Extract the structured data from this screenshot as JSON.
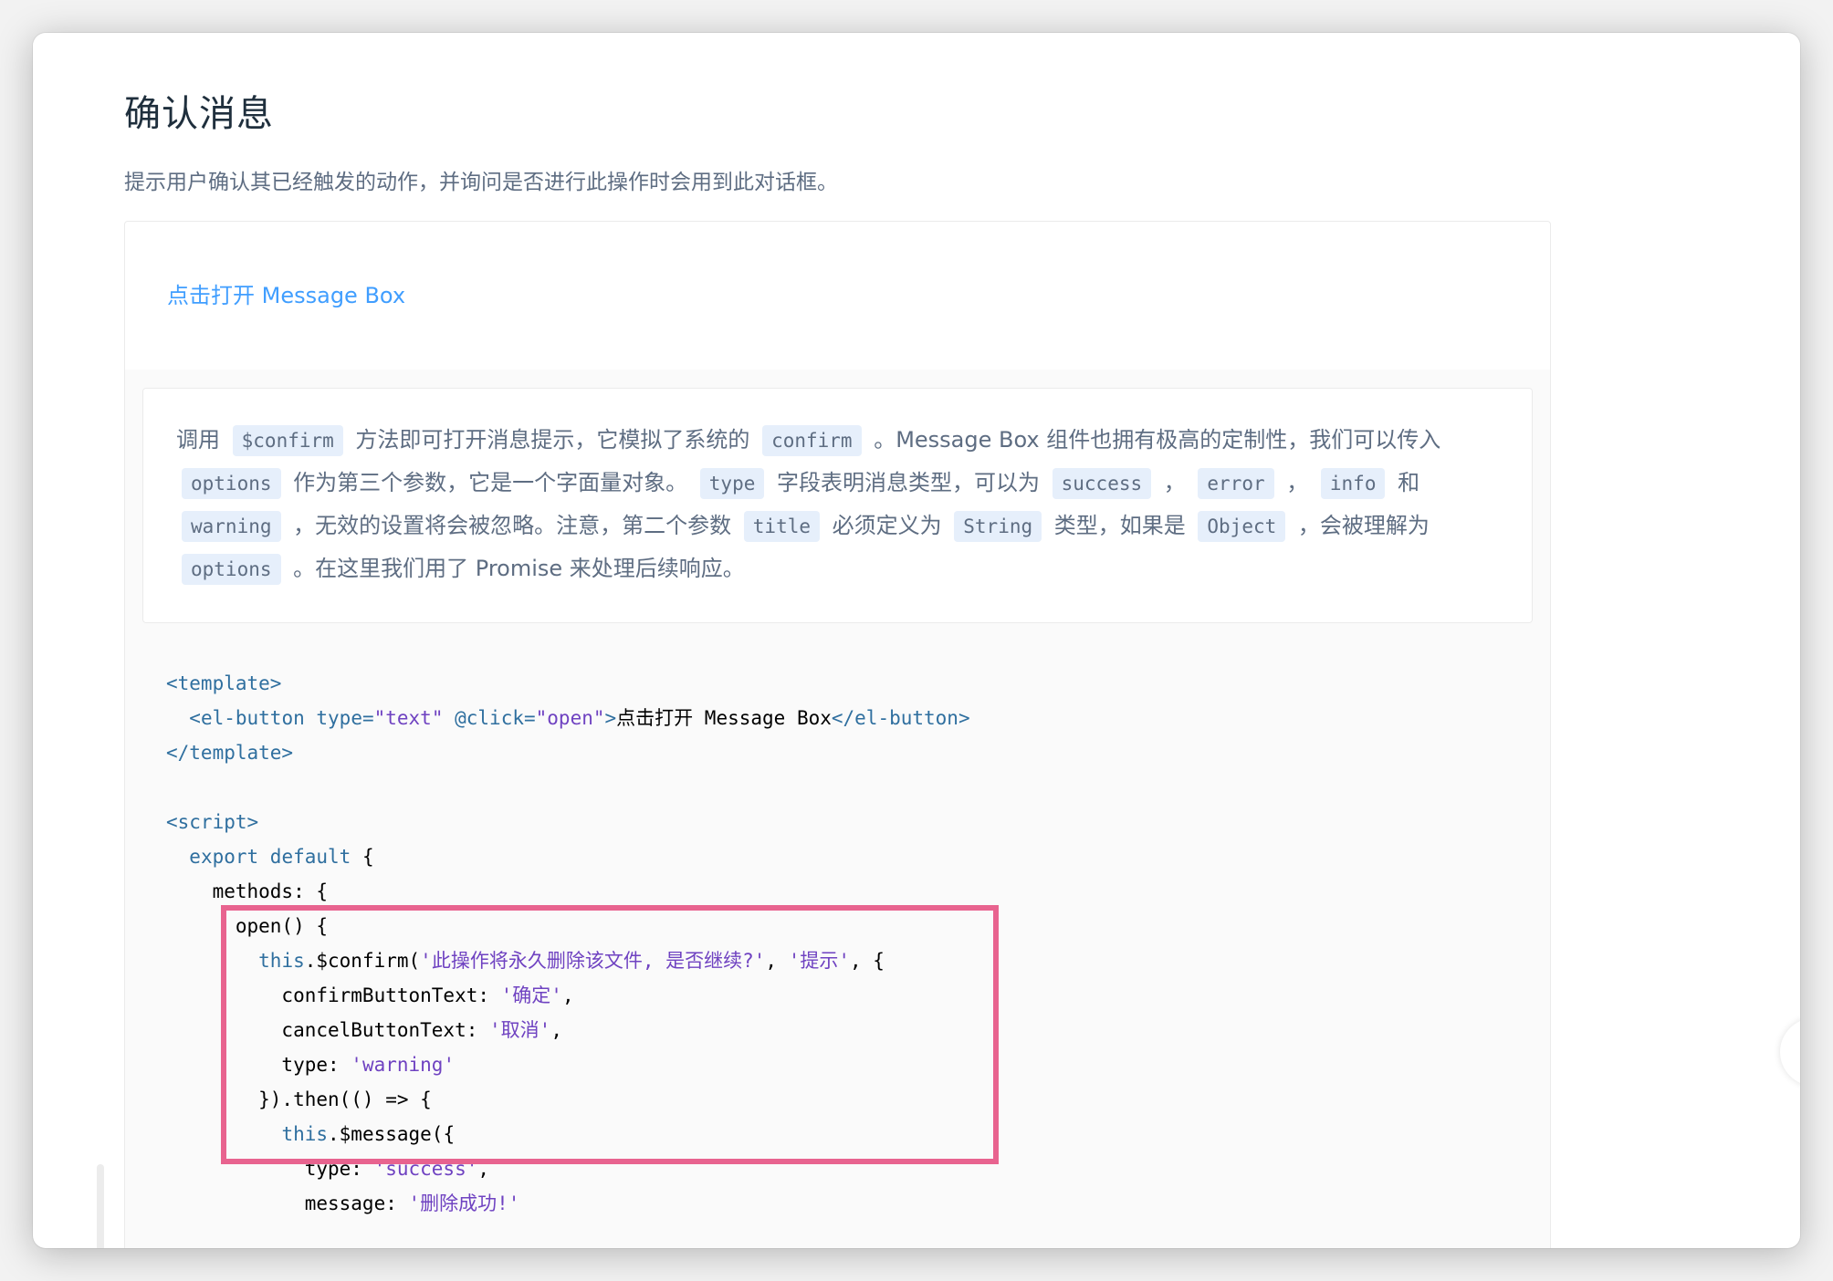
{
  "page": {
    "title": "确认消息",
    "description": "提示用户确认其已经触发的动作，并询问是否进行此操作时会用到此对话框。"
  },
  "demo": {
    "open_link": "点击打开 Message Box"
  },
  "description_parts": [
    {
      "t": "text",
      "v": "调用 "
    },
    {
      "t": "code",
      "v": "$confirm"
    },
    {
      "t": "text",
      "v": " 方法即可打开消息提示，它模拟了系统的 "
    },
    {
      "t": "code",
      "v": "confirm"
    },
    {
      "t": "text",
      "v": " 。Message Box 组件也拥有极高的定制性，我们可以传入 "
    },
    {
      "t": "code",
      "v": "options"
    },
    {
      "t": "text",
      "v": " 作为第三个参数，它是一个字面量对象。 "
    },
    {
      "t": "code",
      "v": "type"
    },
    {
      "t": "text",
      "v": " 字段表明消息类型，可以为 "
    },
    {
      "t": "code",
      "v": "success"
    },
    {
      "t": "text",
      "v": " ， "
    },
    {
      "t": "code",
      "v": "error"
    },
    {
      "t": "text",
      "v": " ， "
    },
    {
      "t": "code",
      "v": "info"
    },
    {
      "t": "text",
      "v": " 和 "
    },
    {
      "t": "code",
      "v": "warning"
    },
    {
      "t": "text",
      "v": " ，无效的设置将会被忽略。注意，第二个参数 "
    },
    {
      "t": "code",
      "v": "title"
    },
    {
      "t": "text",
      "v": " 必须定义为 "
    },
    {
      "t": "code",
      "v": "String"
    },
    {
      "t": "text",
      "v": " 类型，如果是 "
    },
    {
      "t": "code",
      "v": "Object"
    },
    {
      "t": "text",
      "v": " ，会被理解为 "
    },
    {
      "t": "code",
      "v": "options"
    },
    {
      "t": "text",
      "v": " 。在这里我们用了 Promise 来处理后续响应。"
    }
  ],
  "code_lines": [
    [
      {
        "c": "tag",
        "v": "<template>"
      }
    ],
    [
      {
        "c": "plain",
        "v": "  "
      },
      {
        "c": "tag",
        "v": "<el-button"
      },
      {
        "c": "plain",
        "v": " "
      },
      {
        "c": "attr",
        "v": "type="
      },
      {
        "c": "str",
        "v": "\"text\""
      },
      {
        "c": "plain",
        "v": " "
      },
      {
        "c": "attr",
        "v": "@click="
      },
      {
        "c": "str",
        "v": "\"open\""
      },
      {
        "c": "tag",
        "v": ">"
      },
      {
        "c": "plain",
        "v": "点击打开 Message Box"
      },
      {
        "c": "tag",
        "v": "</el-button>"
      }
    ],
    [
      {
        "c": "tag",
        "v": "</template>"
      }
    ],
    [],
    [
      {
        "c": "tag",
        "v": "<script>"
      }
    ],
    [
      {
        "c": "plain",
        "v": "  "
      },
      {
        "c": "kw",
        "v": "export default"
      },
      {
        "c": "plain",
        "v": " {"
      }
    ],
    [
      {
        "c": "plain",
        "v": "    methods: {"
      }
    ],
    [
      {
        "c": "plain",
        "v": "      open() {"
      }
    ],
    [
      {
        "c": "plain",
        "v": "        "
      },
      {
        "c": "kw",
        "v": "this"
      },
      {
        "c": "plain",
        "v": ".$confirm("
      },
      {
        "c": "str",
        "v": "'此操作将永久删除该文件, 是否继续?'"
      },
      {
        "c": "plain",
        "v": ", "
      },
      {
        "c": "str",
        "v": "'提示'"
      },
      {
        "c": "plain",
        "v": ", {"
      }
    ],
    [
      {
        "c": "plain",
        "v": "          confirmButtonText: "
      },
      {
        "c": "str",
        "v": "'确定'"
      },
      {
        "c": "plain",
        "v": ","
      }
    ],
    [
      {
        "c": "plain",
        "v": "          cancelButtonText: "
      },
      {
        "c": "str",
        "v": "'取消'"
      },
      {
        "c": "plain",
        "v": ","
      }
    ],
    [
      {
        "c": "plain",
        "v": "          type: "
      },
      {
        "c": "str",
        "v": "'warning'"
      }
    ],
    [
      {
        "c": "plain",
        "v": "        }).then(() => {"
      }
    ],
    [
      {
        "c": "plain",
        "v": "          "
      },
      {
        "c": "kw",
        "v": "this"
      },
      {
        "c": "plain",
        "v": ".$message({"
      }
    ],
    [
      {
        "c": "plain",
        "v": "            type: "
      },
      {
        "c": "str",
        "v": "'success'"
      },
      {
        "c": "plain",
        "v": ","
      }
    ],
    [
      {
        "c": "plain",
        "v": "            message: "
      },
      {
        "c": "str",
        "v": "'删除成功!'"
      }
    ]
  ],
  "colors": {
    "link": "#409eff",
    "highlight_border": "#e8638f",
    "code_tag": "#2f6f9f",
    "code_string": "#6f42c1",
    "inline_code_bg": "#e6effb"
  },
  "icons": {
    "back_to_top": "caret-up-icon"
  }
}
